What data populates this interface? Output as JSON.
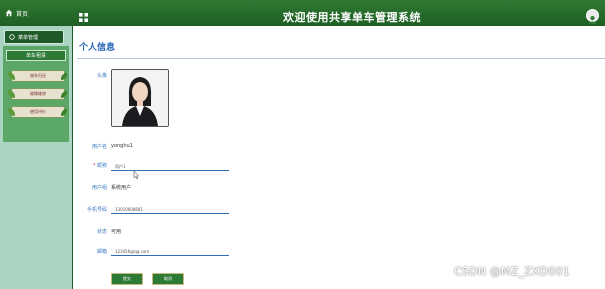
{
  "header": {
    "home_label": "首页",
    "title": "欢迎使用共享单车管理系统"
  },
  "sidebar": {
    "menu_head": "菜单管理",
    "group_title": "单车租赁",
    "items": [
      {
        "label": "借车归还"
      },
      {
        "label": "故障维修"
      },
      {
        "label": "使用评价"
      }
    ]
  },
  "main": {
    "page_title": "个人信息",
    "fields": {
      "avatar_label": "头像",
      "username_label": "用户名",
      "username_value": "yonghu1",
      "nickname_label": "昵称",
      "nickname_value": "用户1",
      "group_label": "用户组",
      "group_value": "系统用户",
      "phone_label": "手机号码",
      "phone_value": "13010608681",
      "status_label": "状态",
      "status_value": "可用",
      "email_label": "邮箱",
      "email_value": "123456@qq.com"
    },
    "buttons": {
      "submit": "提交",
      "cancel": "取消"
    }
  },
  "watermark": "CSDN @MZ_ZXD001",
  "colors": {
    "header_green": "#1f5e24",
    "sidebar_bg": "#a9d4c1",
    "label_blue": "#3a78c0"
  }
}
